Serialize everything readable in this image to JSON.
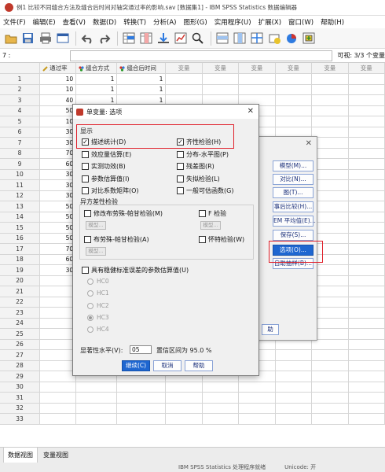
{
  "window": {
    "title": "例1 比较不同缝合方法及缝合后时间对轴突通过率的影响.sav [数据集1] - IBM SPSS Statistics 数据编辑器"
  },
  "menu": [
    "文件(F)",
    "编辑(E)",
    "查看(V)",
    "数据(D)",
    "转换(T)",
    "分析(A)",
    "图形(G)",
    "实用程序(U)",
    "扩展(X)",
    "窗口(W)",
    "帮助(H)"
  ],
  "cellbar": {
    "ref": "7 :",
    "value": "",
    "visible": "可视: 3/3 个变量"
  },
  "grid": {
    "columns": [
      "通过率",
      "缝合方式",
      "缝合后时间",
      "变量",
      "变量",
      "变量",
      "变量",
      "变量",
      "变量"
    ],
    "rows": [
      [
        "1",
        "10",
        "1",
        "1"
      ],
      [
        "2",
        "10",
        "1",
        "1"
      ],
      [
        "3",
        "40",
        "1",
        "1"
      ],
      [
        "4",
        "50",
        "1",
        "1"
      ],
      [
        "5",
        "10",
        "",
        ""
      ],
      [
        "6",
        "30",
        "",
        ""
      ],
      [
        "7",
        "30",
        "",
        ""
      ],
      [
        "8",
        "70",
        "",
        ""
      ],
      [
        "9",
        "60",
        "",
        ""
      ],
      [
        "10",
        "30",
        "",
        ""
      ],
      [
        "11",
        "30",
        "",
        ""
      ],
      [
        "12",
        "30",
        "",
        ""
      ],
      [
        "13",
        "50",
        "",
        ""
      ],
      [
        "14",
        "50",
        "",
        ""
      ],
      [
        "15",
        "50",
        "",
        ""
      ],
      [
        "16",
        "50",
        "",
        ""
      ],
      [
        "17",
        "70",
        "",
        ""
      ],
      [
        "18",
        "60",
        "",
        ""
      ],
      [
        "19",
        "30",
        "",
        ""
      ],
      [
        "20",
        "",
        "",
        ""
      ],
      [
        "21",
        "",
        "",
        ""
      ],
      [
        "22",
        "",
        "",
        ""
      ],
      [
        "23",
        "",
        "",
        ""
      ],
      [
        "24",
        "",
        "",
        ""
      ],
      [
        "25",
        "",
        "",
        ""
      ],
      [
        "26",
        "",
        "",
        ""
      ],
      [
        "27",
        "",
        "",
        ""
      ],
      [
        "28",
        "",
        "",
        ""
      ],
      [
        "29",
        "",
        "",
        ""
      ],
      [
        "30",
        "",
        "",
        ""
      ],
      [
        "31",
        "",
        "",
        ""
      ],
      [
        "32",
        "",
        "",
        ""
      ],
      [
        "33",
        "",
        "",
        ""
      ]
    ]
  },
  "parent_dialog": {
    "buttons": [
      "模型(M)...",
      "对比(N)...",
      "图(T)...",
      "事后比较(H)...",
      "EM 平均值(E)...",
      "保存(S)...",
      "选项(O)...",
      "自助抽样(B)..."
    ],
    "bottom_button": "助"
  },
  "options_dialog": {
    "title": "单变量: 选项",
    "display_label": "显示",
    "display_items": [
      {
        "label": "描述统计(D)",
        "checked": true
      },
      {
        "label": "齐性检验(H)",
        "checked": true
      },
      {
        "label": "效应量估算(E)",
        "checked": false
      },
      {
        "label": "分布-水平图(P)",
        "checked": false
      },
      {
        "label": "实测功效(B)",
        "checked": false
      },
      {
        "label": "残差图(R)",
        "checked": false
      },
      {
        "label": "参数估算值(I)",
        "checked": false
      },
      {
        "label": "失拟检验(L)",
        "checked": false
      },
      {
        "label": "对比系数矩阵(O)",
        "checked": false
      },
      {
        "label": "一般可估函数(G)",
        "checked": false
      }
    ],
    "hetero_label": "异方差性检验",
    "hetero_items": [
      {
        "label": "修改布劳殊-帕甘检验(M)"
      },
      {
        "label": "F 检验"
      },
      {
        "label": "布劳殊-帕甘检验(A)"
      },
      {
        "label": "怀特检验(W)"
      }
    ],
    "model_button": "模型...",
    "robust_label": "具有稳健标准误差的参数估算值(U)",
    "hc_options": [
      "HC0",
      "HC1",
      "HC2",
      "HC3",
      "HC4"
    ],
    "hc_selected": "HC3",
    "significance_label": "显著性水平(V):",
    "significance_value": "05",
    "confidence_text": "置信区间为 95.0 %",
    "buttons": {
      "continue": "继续(C)",
      "cancel": "取消",
      "help": "帮助"
    }
  },
  "tabs": [
    "数据视图",
    "变量视图"
  ],
  "status": {
    "processor": "IBM SPSS Statistics 处理程序就绪",
    "encoding": "Unicode: 开"
  },
  "colors": {
    "accent": "#1e66d0",
    "highlight": "#e0202a"
  }
}
